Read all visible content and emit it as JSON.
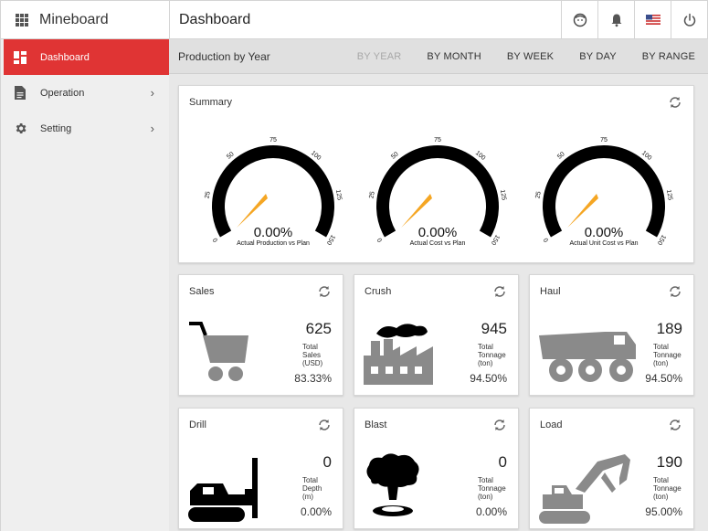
{
  "app": {
    "title": "Mineboard",
    "page_title": "Dashboard",
    "toolbar_icons": [
      "face-icon",
      "bell-icon",
      "flag-us-icon",
      "power-icon"
    ]
  },
  "sidebar": {
    "items": [
      {
        "label": "Dashboard",
        "icon": "dashboard-icon",
        "active": true
      },
      {
        "label": "Operation",
        "icon": "document-icon",
        "has_children": true
      },
      {
        "label": "Setting",
        "icon": "gear-icon",
        "has_children": true
      }
    ],
    "active_color": "#e03434"
  },
  "subheader": {
    "title": "Production by Year",
    "filters": [
      {
        "label": "BY YEAR",
        "disabled": true
      },
      {
        "label": "BY MONTH",
        "disabled": false
      },
      {
        "label": "BY WEEK",
        "disabled": false
      },
      {
        "label": "BY DAY",
        "disabled": false
      },
      {
        "label": "BY RANGE",
        "disabled": false
      }
    ]
  },
  "summary": {
    "title": "Summary",
    "scale_ticks": [
      "0",
      "25",
      "50",
      "75",
      "100",
      "125",
      "150"
    ],
    "needle_color": "#f5a623",
    "gauges": [
      {
        "value": "0.00%",
        "label": "Actual Production vs Plan"
      },
      {
        "value": "0.00%",
        "label": "Actual Cost vs Plan"
      },
      {
        "value": "0.00%",
        "label": "Actual Unit Cost vs Plan"
      }
    ]
  },
  "kpis": [
    {
      "title": "Sales",
      "icon": "shopping-cart-icon",
      "value": "625",
      "desc": "Total\nSales\n(USD)",
      "pct": "83.33%"
    },
    {
      "title": "Crush",
      "icon": "factory-icon",
      "value": "945",
      "desc": "Total\nTonnage\n(ton)",
      "pct": "94.50%"
    },
    {
      "title": "Haul",
      "icon": "dump-truck-icon",
      "value": "189",
      "desc": "Total\nTonnage\n(ton)",
      "pct": "94.50%"
    },
    {
      "title": "Drill",
      "icon": "drill-rig-icon",
      "value": "0",
      "desc": "Total\nDepth\n(m)",
      "pct": "0.00%"
    },
    {
      "title": "Blast",
      "icon": "explosion-icon",
      "value": "0",
      "desc": "Total\nTonnage\n(ton)",
      "pct": "0.00%"
    },
    {
      "title": "Load",
      "icon": "excavator-icon",
      "value": "190",
      "desc": "Total\nTonnage\n(ton)",
      "pct": "95.00%"
    }
  ]
}
